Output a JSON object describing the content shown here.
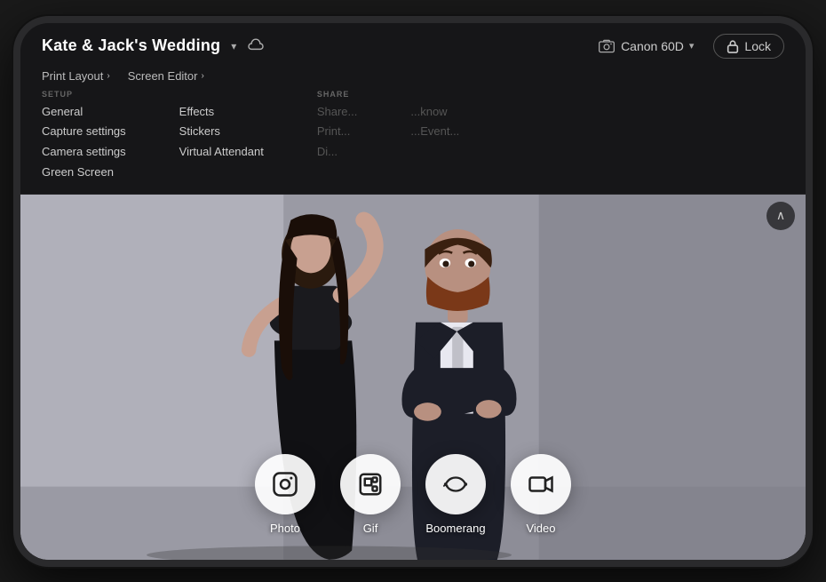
{
  "header": {
    "project_title": "Kate & Jack's Wedding",
    "chevron_label": "▾",
    "cloud_icon_label": "☁",
    "camera_label": "Canon 60D",
    "chevron_camera": "▾",
    "lock_label": "Lock"
  },
  "menubar": {
    "links": [
      {
        "label": "Print Layout",
        "arrow": "›"
      },
      {
        "label": "Screen Editor",
        "arrow": "›"
      }
    ],
    "sections": [
      {
        "id": "setup",
        "label": "SETUP",
        "items": [
          "General",
          "Capture settings",
          "Camera settings",
          "Green Screen"
        ]
      },
      {
        "id": "effects",
        "label": "",
        "items": [
          "Effects",
          "Stickers",
          "Virtual Attendant"
        ]
      },
      {
        "id": "share",
        "label": "SHAR...",
        "items": [
          "Sha...",
          "Pri...",
          "Di..."
        ]
      },
      {
        "id": "share2",
        "label": "",
        "items": [
          "...now",
          "...Eve..."
        ]
      }
    ]
  },
  "capture_modes": [
    {
      "id": "photo",
      "label": "Photo",
      "icon": "instagram"
    },
    {
      "id": "gif",
      "label": "Gif",
      "icon": "layers"
    },
    {
      "id": "boomerang",
      "label": "Boomerang",
      "icon": "infinity"
    },
    {
      "id": "video",
      "label": "Video",
      "icon": "video"
    }
  ],
  "ui": {
    "collapse_icon": "∧"
  }
}
